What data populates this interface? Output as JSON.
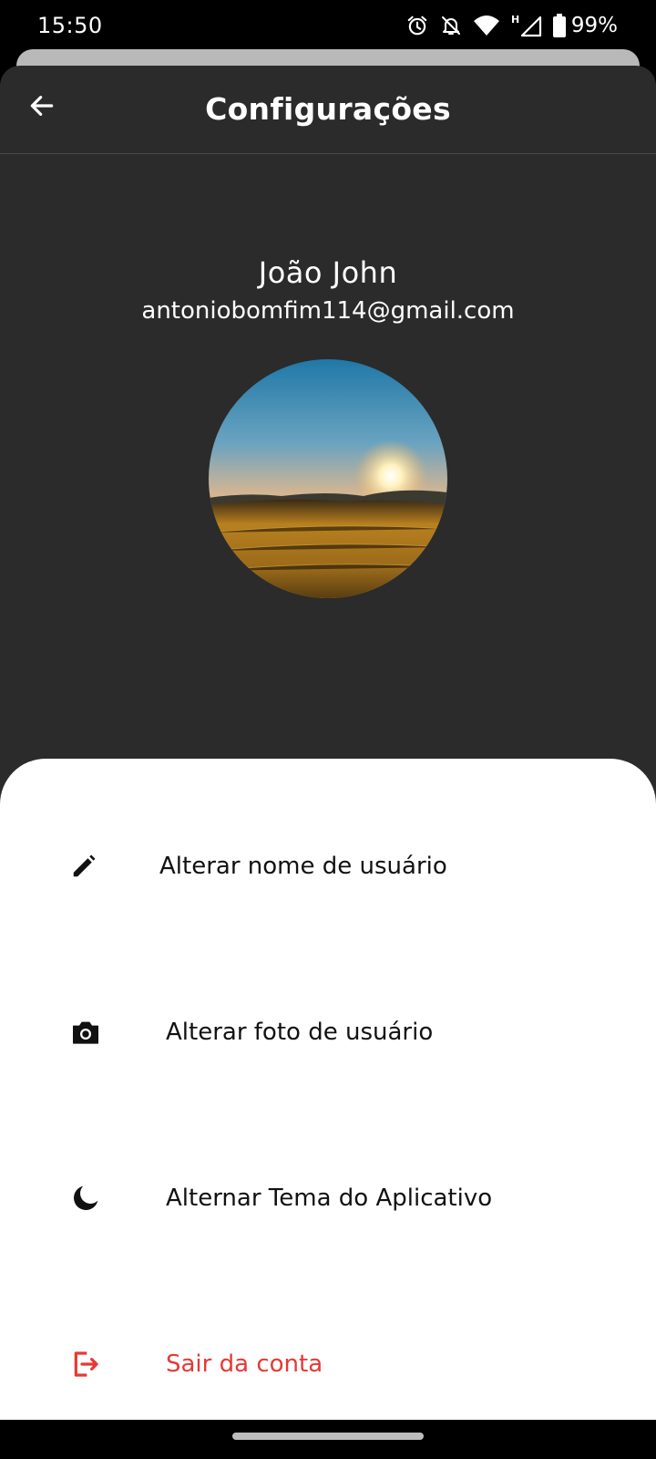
{
  "status_bar": {
    "time": "15:50",
    "battery": "99%",
    "icons": [
      "alarm-icon",
      "notifications-off-icon",
      "wifi-icon",
      "signal-icon",
      "battery-icon"
    ]
  },
  "app_bar": {
    "title": "Configurações",
    "back_icon": "arrow-left-icon"
  },
  "profile": {
    "name": "João John",
    "email": "antoniobomfim114@gmail.com"
  },
  "menu": {
    "items": [
      {
        "label": "Alterar nome de usuário",
        "icon": "pencil-icon"
      },
      {
        "label": "Alterar foto de usuário",
        "icon": "camera-icon"
      },
      {
        "label": "Alternar Tema do Aplicativo",
        "icon": "moon-icon"
      },
      {
        "label": "Sair da conta",
        "icon": "logout-icon"
      }
    ]
  },
  "colors": {
    "panel": "#2b2b2b",
    "sheet": "#ffffff",
    "danger": "#e53935"
  }
}
